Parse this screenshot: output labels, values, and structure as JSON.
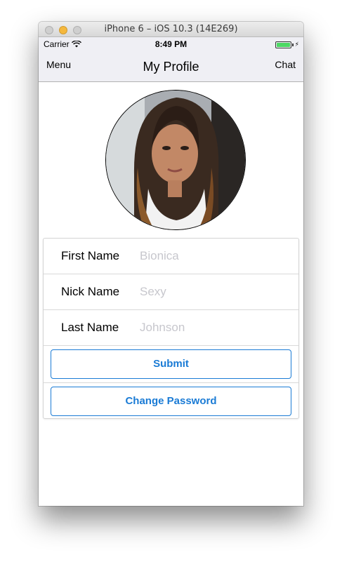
{
  "window": {
    "title": "iPhone 6 – iOS 10.3 (14E269)"
  },
  "status_bar": {
    "carrier": "Carrier",
    "time": "8:49 PM"
  },
  "nav": {
    "left": "Menu",
    "title": "My Profile",
    "right": "Chat"
  },
  "form": {
    "first_name": {
      "label": "First Name",
      "placeholder": "Bionica"
    },
    "nick_name": {
      "label": "Nick Name",
      "placeholder": "Sexy"
    },
    "last_name": {
      "label": "Last Name",
      "placeholder": "Johnson"
    },
    "submit_label": "Submit",
    "change_password_label": "Change Password"
  },
  "colors": {
    "accent": "#1a7bd5",
    "battery": "#4cd964",
    "nav_background": "#efeff4",
    "placeholder": "#c7c7cd"
  },
  "icons": [
    "wifi-icon",
    "battery-icon",
    "charging-bolt-icon"
  ]
}
